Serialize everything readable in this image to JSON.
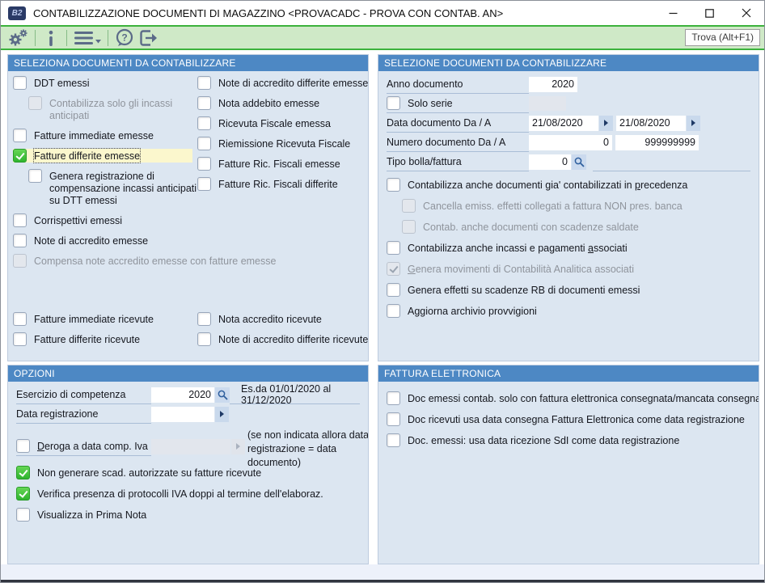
{
  "window": {
    "title": "CONTABILIZZAZIONE DOCUMENTI DI MAGAZZINO <PROVACADC - PROVA CON CONTAB. AN>",
    "logo_text": "B2",
    "controls": [
      "minimize-icon",
      "maximize-icon",
      "close-icon"
    ]
  },
  "toolbar": {
    "icons": [
      "settings-gears-icon",
      "info-icon",
      "menu-icon",
      "chevron-down-icon",
      "help-bubble-icon",
      "exit-icon"
    ],
    "trova_label": "Trova (Alt+F1)"
  },
  "colors": {
    "accent_green": "#3cb23c",
    "toolbar_bg": "#cfe9c7",
    "panel_header": "#4d88c4",
    "panel_body": "#dce6f1",
    "checked_green": "#2eb42e",
    "focus_highlight": "#fbf7cd"
  },
  "panels": {
    "seleziona": {
      "title": "SELEZIONA DOCUMENTI DA CONTABILIZZARE",
      "left": [
        {
          "label": "DDT emessi"
        },
        {
          "label": "Contabilizza solo gli incassi anticipati",
          "disabled": true,
          "indent": 1,
          "maxw": 162
        },
        {
          "label": "Fatture immediate emesse"
        },
        {
          "label": "Fatture differite emesse",
          "checked": true,
          "highlight": true,
          "focused": true
        },
        {
          "label": "Genera registrazione di compensazione incassi anticipati su DTT emessi",
          "indent": 1,
          "maxw": 214
        },
        {
          "label": "Corrispettivi emessi"
        },
        {
          "label": "Note di accredito emesse"
        },
        {
          "label": "Compensa note accredito emesse con fatture emesse",
          "disabled": true
        },
        {
          "label": "Fatture immediate ricevute",
          "push": true
        },
        {
          "label": "Fatture differite ricevute"
        }
      ],
      "right": [
        {
          "label": "Note di accredito differite emesse"
        },
        {
          "label": "Nota addebito emesse"
        },
        {
          "label": "Ricevuta Fiscale emessa"
        },
        {
          "label": "Riemissione Ricevuta Fiscale"
        },
        {
          "label": "Fatture Ric. Fiscali emesse"
        },
        {
          "label": "Fatture Ric. Fiscali differite"
        },
        {
          "label": "Nota accredito ricevute",
          "push": true
        },
        {
          "label": "Note di accredito differite ricevute"
        }
      ]
    },
    "selezione": {
      "title": "SELEZIONE DOCUMENTI DA CONTABILIZZARE",
      "anno_label": "Anno documento",
      "anno_value": "2020",
      "solo_serie_label": "Solo serie",
      "data_label": "Data documento Da / A",
      "data_da": "21/08/2020",
      "data_a": "21/08/2020",
      "numero_label": "Numero documento Da / A",
      "numero_da": "0",
      "numero_a": "999999999",
      "tipo_label": "Tipo bolla/fattura",
      "tipo_value": "0",
      "checks": [
        {
          "label": "Contabilizza anche documenti gia' contabilizzati in &precedenza"
        },
        {
          "label": "Cancella emiss. effetti collegati a fattura NON pres. banca",
          "disabled": true,
          "indent": 1
        },
        {
          "label": "Contab. anche documenti con scadenze saldate",
          "disabled": true,
          "indent": 1
        },
        {
          "label": "Contabilizza anche incassi e pagamenti &associati"
        },
        {
          "label": "&Genera movimenti di Contabilità Analitica associati",
          "disabled": true,
          "checked": true
        },
        {
          "label": "Genera effetti su scadenze RB di documenti emessi"
        },
        {
          "label": "Aggiorna archivio provvigioni"
        }
      ]
    },
    "opzioni": {
      "title": "OPZIONI",
      "esercizio_label": "Esercizio di competenza",
      "esercizio_value": "2020",
      "esercizio_note": "Es.da 01/01/2020 al 31/12/2020",
      "data_reg_label": "Data registrazione",
      "data_reg_note": "(se non indicata  allora data registrazione = data documento)",
      "deroga_label": "&Deroga a data comp. Iva",
      "checks": [
        {
          "label": "Non generare scad. autorizzate su fatture ricevute",
          "checked": true
        },
        {
          "label": "Verifica presenza di protocolli IVA doppi al termine dell'elaboraz.",
          "checked": true
        },
        {
          "label": "Visualizza in Prima Nota"
        }
      ]
    },
    "fattura": {
      "title": "FATTURA ELETTRONICA",
      "checks": [
        {
          "label": "Doc emessi contab. solo con fattura elettronica consegnata/mancata consegna"
        },
        {
          "label": "Doc ricevuti usa data consegna Fattura Elettronica come data registrazione"
        },
        {
          "label": "Doc. emessi: usa data ricezione SdI come data registrazione"
        }
      ]
    }
  }
}
